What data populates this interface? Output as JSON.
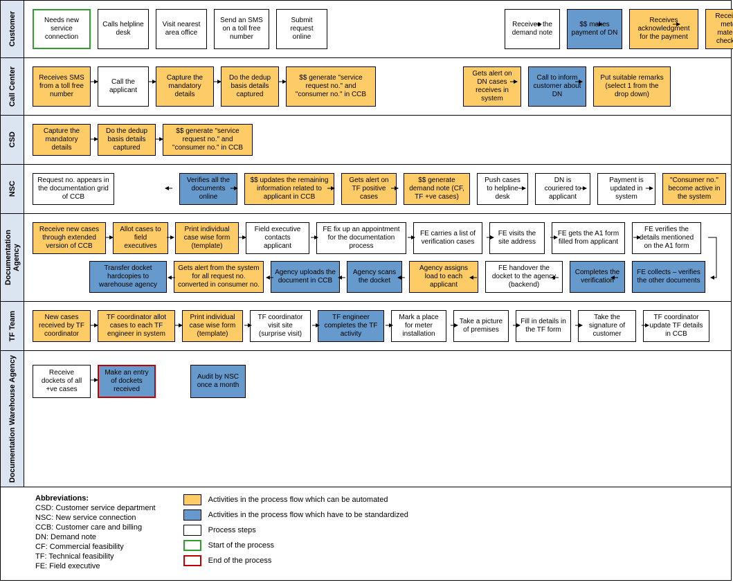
{
  "lanes": {
    "customer": {
      "label": "Customer",
      "cells": {
        "c1": "Needs new service connection",
        "c2": "Calls helpline desk",
        "c3": "Visit nearest area office",
        "c4": "Send an SMS on a toll free number",
        "c5": "Submit request online",
        "c6": "Receives the demand note",
        "c7": "$$ makes payment of DN",
        "c8": "Receives acknowledgment for the payment",
        "c9": "Receives meter material checklist"
      }
    },
    "callcenter": {
      "label": "Call Center",
      "cells": {
        "cc1": "Receives SMS from a toll free number",
        "cc2": "Call the applicant",
        "cc3": "Capture the mandatory details",
        "cc4": "Do the dedup basis details captured",
        "cc5": "$$ generate \"service request no.\" and \"consumer no.\" in CCB",
        "cc6": "Gets alert on DN cases receives in system",
        "cc7": "Call to inform customer about DN",
        "cc8": "Put suitable remarks (select 1 from the drop down)"
      }
    },
    "csd": {
      "label": "CSD",
      "cells": {
        "cs1": "Capture the mandatory details",
        "cs2": "Do the dedup basis details captured",
        "cs3": "$$ generate \"service request no.\" and \"consumer no.\" in CCB"
      }
    },
    "nsc": {
      "label": "NSC",
      "cells": {
        "n1": "Request no. appears in the documentation grid of CCB",
        "n2": "Verifies all the documents online",
        "n3": "$$ updates the remaining information related to applicant in CCB",
        "n4": "Gets alert on TF positive cases",
        "n5": "$$ generate demand note (CF, TF +ve cases)",
        "n6": "Push cases to helpline desk",
        "n7": "DN is couriered to applicant",
        "n8": "Payment is updated in system",
        "n9": "\"Consumer no.\" become active in the system"
      }
    },
    "docagency": {
      "label": "Documentation Agency",
      "cells": {
        "d1": "Receive new cases through extended version of CCB",
        "d2": "Allot cases to field executives",
        "d3": "Print individual case wise form (template)",
        "d4": "Field executive contacts applicant",
        "d5": "FE fix up an appointment for the documentation process",
        "d6": "FE carries a list of verification cases",
        "d7": "FE visits the site address",
        "d8": "FE gets the A1 form filled from applicant",
        "d9": "FE verifies the details mentioned on the A1 form",
        "d10": "Transfer docket hardcopies to warehouse agency",
        "d11": "Gets alert from the system for all request no. converted in consumer no.",
        "d12": "Agency uploads the document in CCB",
        "d13": "Agency scans the docket",
        "d14": "Agency assigns load to each applicant",
        "d15": "FE handover the docket to the agency (backend)",
        "d16": "Completes the verification",
        "d17": "FE collects – verifies the other documents"
      }
    },
    "tf": {
      "label": "TF Team",
      "cells": {
        "t1": "New cases received by TF coordinator",
        "t2": "TF coordinator allot cases to each TF engineer in system",
        "t3": "Print individual case wise form (template)",
        "t4": "TF coordinator visit site (surprise visit)",
        "t5": "TF engineer completes the TF activity",
        "t6": "Mark a place for meter installation",
        "t7": "Take a picture of premises",
        "t8": "Fill in details in the TF form",
        "t9": "Take the signature of customer",
        "t10": "TF coordinator update TF details in CCB"
      }
    },
    "warehouse": {
      "label": "Documentation Warehouse Agency",
      "cells": {
        "w1": "Receive dockets of all +ve cases",
        "w2": "Make an entry of dockets received",
        "w3": "Audit by NSC once a month"
      }
    }
  },
  "legend": {
    "abbr_title": "Abbreviations:",
    "abbr": {
      "csd": "CSD: Customer service department",
      "nsc": "NSC: New service connection",
      "ccb": "CCB: Customer care and billing",
      "dn": "DN: Demand note",
      "cf": "CF: Commercial feasibility",
      "tf": "TF: Technical feasibility",
      "fe": "FE: Field executive"
    },
    "keys": {
      "auto": "Activities in the process flow which can be automated",
      "std": "Activities in the process flow which have to be standardized",
      "plain": "Process steps",
      "start": "Start of the process",
      "end": "End of the process"
    }
  }
}
